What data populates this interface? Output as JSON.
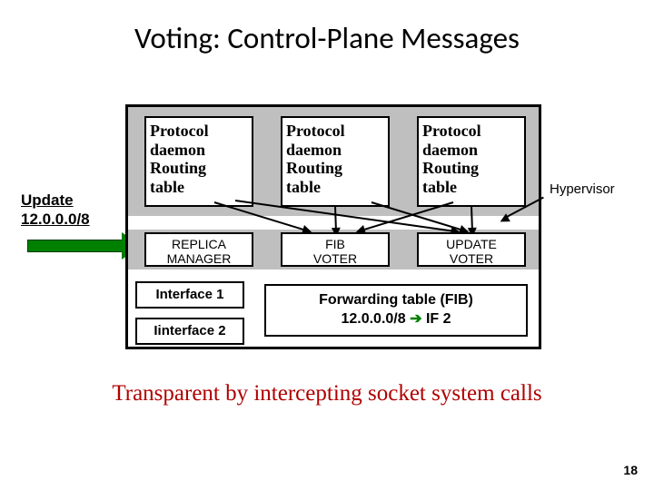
{
  "title": "Voting: Control-Plane Messages",
  "update_label_line1": "Update",
  "update_label_line2": "12.0.0.0/8",
  "daemons": {
    "d1_l1": "Protocol",
    "d1_l2": "daemon",
    "d1_l3": "Routing",
    "d1_l4": "table",
    "d2_l1": "Protocol",
    "d2_l2": "daemon",
    "d2_l3": "Routing",
    "d2_l4": "table",
    "d3_l1": "Protocol",
    "d3_l2": "daemon",
    "d3_l3": "Routing",
    "d3_l4": "table"
  },
  "mid": {
    "m1_l1": "REPLICA",
    "m1_l2": "MANAGER",
    "m2_l1": "FIB",
    "m2_l2": "VOTER",
    "m3_l1": "UPDATE",
    "m3_l2": "VOTER"
  },
  "interfaces": {
    "if1": "Interface 1",
    "if2": "Iinterface 2"
  },
  "fib_l1": "Forwarding table (FIB)",
  "fib_route": "12.0.0.0/8",
  "fib_arrow": "➔",
  "fib_dest": "IF 2",
  "hypervisor_label": "Hypervisor",
  "caption": "Transparent by intercepting socket system calls",
  "slide_number": "18"
}
